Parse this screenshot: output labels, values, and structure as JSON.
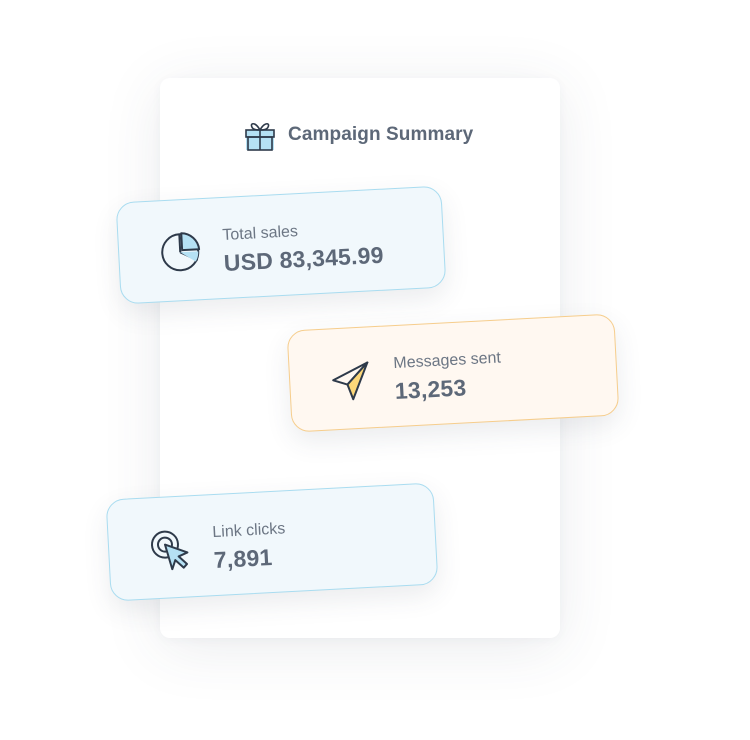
{
  "summary": {
    "title": "Campaign Summary",
    "icon": "gift-icon"
  },
  "cards": [
    {
      "label": "Total sales",
      "value": "USD 83,345.99",
      "icon": "pie-chart-icon",
      "accent": "#a9dcf0",
      "background": "#f1f8fc"
    },
    {
      "label": "Messages sent",
      "value": "13,253",
      "icon": "paper-plane-icon",
      "accent": "#f6cd8c",
      "background": "#fff8f1"
    },
    {
      "label": "Link clicks",
      "value": "7,891",
      "icon": "cursor-click-icon",
      "accent": "#a9dcf0",
      "background": "#f1f8fc"
    }
  ],
  "colors": {
    "icon_stroke": "#2e3a4a",
    "icon_blue_fill": "#b5e1f4",
    "icon_yellow_fill": "#fcd779",
    "heading_text": "#5d6878",
    "label_text": "#6c7684"
  }
}
